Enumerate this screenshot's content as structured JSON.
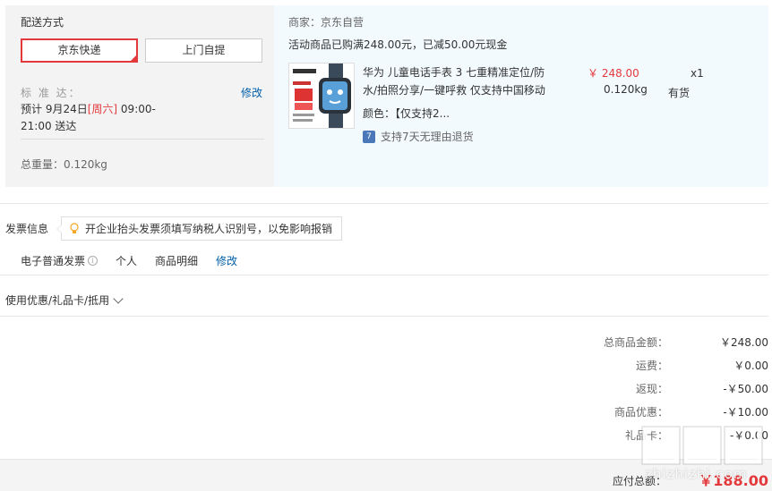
{
  "shipping": {
    "title": "配送方式",
    "options": [
      "京东快递",
      "上门自提"
    ],
    "standard_label": "标 准 达：",
    "edit": "修改",
    "eta_prefix": "预计 9月24日",
    "eta_weekday": "[周六]",
    "eta_time": " 09:00-21:00 送达",
    "total_weight": "总重量：0.120kg"
  },
  "merchant": {
    "name": "商家：京东自营",
    "promo": "活动商品已购满248.00元，已减50.00元现金",
    "product": {
      "name": "华为 儿童电话手表 3 七重精准定位/防水/拍照分享/一键呼救 仅支持中国移动",
      "color": "颜色：【仅支持2...",
      "return_policy": "支持7天无理由退货",
      "return_badge": "7",
      "price": "￥ 248.00",
      "weight": "0.120kg",
      "quantity": "x1",
      "stock": "有货"
    }
  },
  "invoice": {
    "title": "发票信息",
    "tip": "开企业抬头发票须填写纳税人识别号，以免影响报销",
    "type": "电子普通发票",
    "holder": "个人",
    "content": "商品明细",
    "edit": "修改"
  },
  "coupon": {
    "label": "使用优惠/礼品卡/抵用"
  },
  "summary": [
    {
      "label": "总商品金额：",
      "value": "￥248.00"
    },
    {
      "label": "运费：",
      "value": "￥0.00"
    },
    {
      "label": "返现：",
      "value": "-￥50.00"
    },
    {
      "label": "商品优惠：",
      "value": "-￥10.00"
    },
    {
      "label": "礼品卡：",
      "value": "-￥0.00"
    }
  ],
  "total": {
    "label": "应付总额：",
    "value": "￥188.00"
  },
  "watermark": "zhizhizhi.com",
  "colors": {
    "accent_red": "#e4393c",
    "link_blue": "#005ea7",
    "merchant_bg": "#f3fafe"
  }
}
